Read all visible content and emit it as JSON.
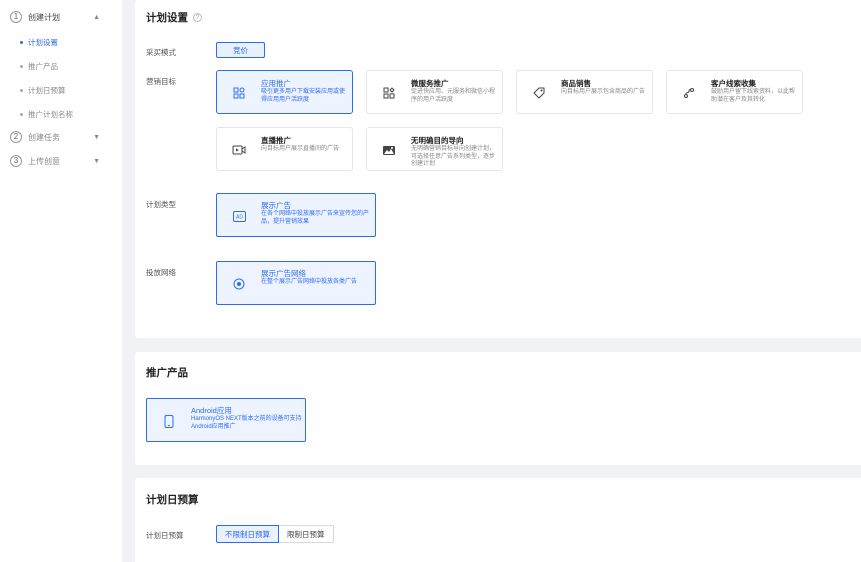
{
  "sidebar": {
    "steps": [
      {
        "num": "1",
        "label": "创建计划",
        "arrow": "▲"
      },
      {
        "num": "2",
        "label": "创建任务",
        "arrow": "▼"
      },
      {
        "num": "3",
        "label": "上传创意",
        "arrow": "▼"
      }
    ],
    "subitems": [
      "计划设置",
      "推广产品",
      "计划日预算",
      "推广计划名称"
    ]
  },
  "plan_settings": {
    "title": "计划设置",
    "help": "?",
    "procurement_label": "采买模式",
    "procurement_value": "竞价",
    "marketing_label": "营销目标",
    "marketing_targets": [
      {
        "title": "应用推广",
        "desc": "吸引更多用户下载安装应用或使得应用用户活跃度",
        "icon": "grid-apps-icon"
      },
      {
        "title": "微服务推广",
        "desc": "促进快应用、元服务和微信小程序的用户活跃度",
        "icon": "widget-icon"
      },
      {
        "title": "商品销售",
        "desc": "向目标用户展示包含商品的广告",
        "icon": "tag-icon"
      },
      {
        "title": "客户线索收集",
        "desc": "鼓励用户留下线索资料，以此帮助潜在客户及其转化",
        "icon": "route-icon"
      },
      {
        "title": "直播推广",
        "desc": "向目标用户展示直播间的广告",
        "icon": "live-icon"
      },
      {
        "title": "无明确目的导向",
        "desc": "无明确营销目标导向创建计划，可选择任意广告系列类型，逐步创建计划",
        "icon": "landscape-icon"
      }
    ],
    "plan_type_label": "计划类型",
    "plan_type": {
      "title": "展示广告",
      "desc": "在各个网络中投放展示广告来宣传您的产品，提升营销效果"
    },
    "network_label": "投放网络",
    "network": {
      "title": "展示广告网络",
      "desc": "在整个展示广告网络中投放各类广告"
    }
  },
  "product": {
    "title": "推广产品",
    "item": {
      "title": "Android应用",
      "desc": "HarmonyOS NEXT版本之前的设备可支持Android应用推广"
    }
  },
  "budget": {
    "title": "计划日预算",
    "label": "计划日预算",
    "options": [
      "不限制日预算",
      "限制日预算"
    ]
  },
  "colors": {
    "accent": "#2f6bf0",
    "selected_bg": "#eef4ff",
    "page_bg": "#f0f2f5"
  }
}
